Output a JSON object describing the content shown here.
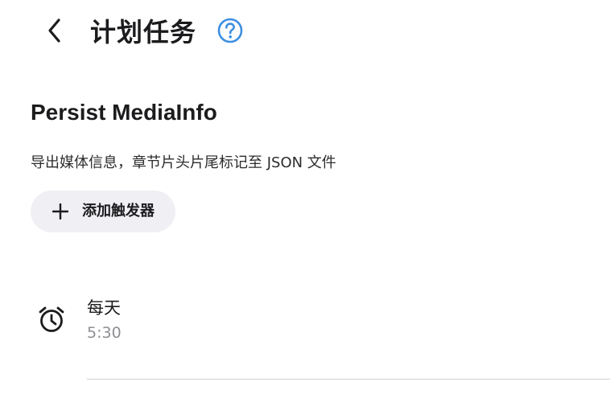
{
  "header": {
    "title": "计划任务",
    "back_icon": "chevron-left-icon",
    "help_icon": "question-circle-icon"
  },
  "task": {
    "name": "Persist MediaInfo",
    "description": "导出媒体信息，章节片头片尾标记至 JSON 文件"
  },
  "actions": {
    "add_trigger_label": "添加触发器",
    "add_icon": "plus-icon"
  },
  "triggers": [
    {
      "frequency": "每天",
      "time": "5:30",
      "icon": "alarm-clock-icon"
    }
  ],
  "colors": {
    "accent": "#3d8fe0",
    "button_bg": "#f0eff4",
    "secondary_text": "#8e8e93",
    "divider": "#d1d1d6"
  }
}
